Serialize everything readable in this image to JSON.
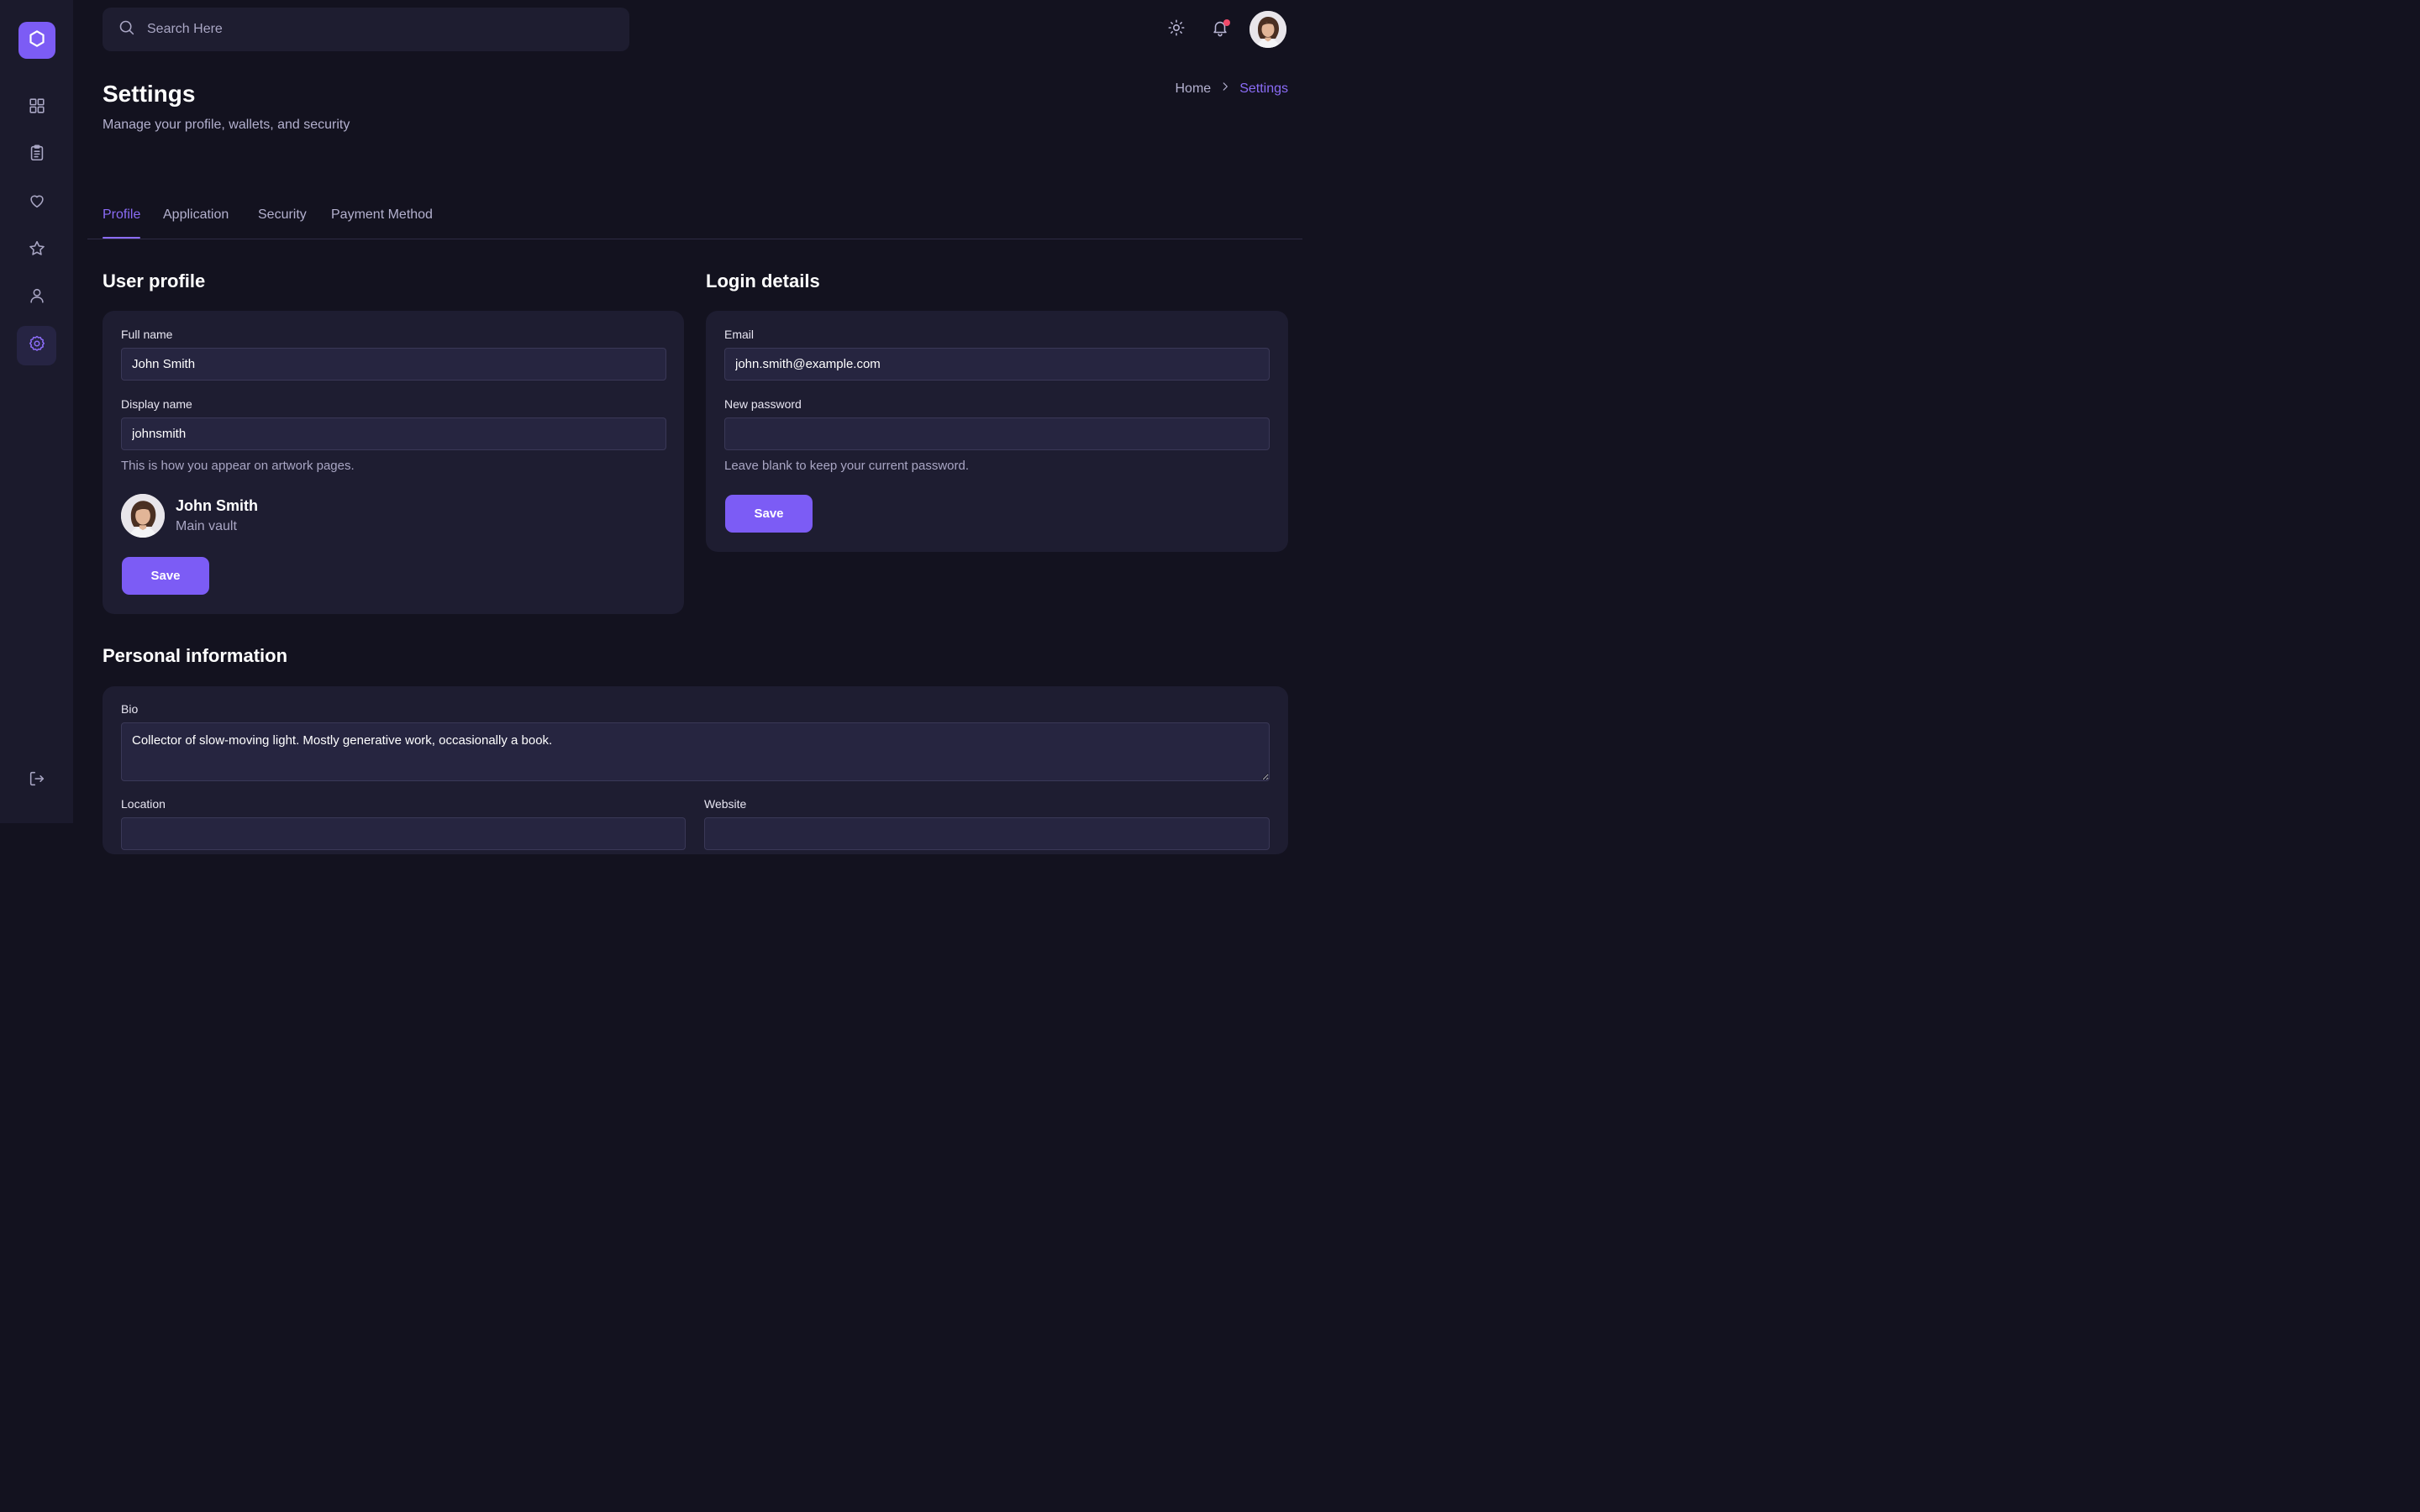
{
  "search": {
    "placeholder": "Search Here"
  },
  "header": {
    "title": "Settings",
    "subtitle": "Manage your profile, wallets, and security",
    "breadcrumb": [
      "Home",
      "Settings"
    ]
  },
  "tabs": [
    {
      "label": "Profile",
      "active": true
    },
    {
      "label": "Application",
      "active": false
    },
    {
      "label": "Security",
      "active": false
    },
    {
      "label": "Payment Method",
      "active": false
    }
  ],
  "sidebar": {
    "items": [
      {
        "icon": "dashboard-grid-icon"
      },
      {
        "icon": "clipboard-icon"
      },
      {
        "icon": "heart-icon"
      },
      {
        "icon": "star-icon"
      },
      {
        "icon": "user-icon"
      },
      {
        "icon": "gear-icon",
        "active": true
      }
    ],
    "bottom": {
      "icon": "logout-icon"
    }
  },
  "user_profile": {
    "title": "User profile",
    "full_name_label": "Full name",
    "full_name_value": "John Smith",
    "display_name_label": "Display name",
    "display_name_value": "johnsmith",
    "hint": "This is how you appear on artwork pages.",
    "preview_name": "John Smith",
    "preview_sub": "Main vault",
    "save_label": "Save"
  },
  "login_details": {
    "title": "Login details",
    "email_label": "Email",
    "email_value": "john.smith@example.com",
    "password_label": "New password",
    "password_value": "",
    "hint": "Leave blank to keep your current password.",
    "save_label": "Save"
  },
  "personal_info": {
    "title": "Personal information",
    "bio_label": "Bio",
    "bio_value": "Collector of slow-moving light. Mostly generative work, occasionally a book.",
    "location_label": "Location",
    "website_label": "Website"
  },
  "colors": {
    "accent": "#7c5cf5",
    "background": "#13121f",
    "sidebar": "#1b1a2c",
    "card": "#1e1d31",
    "notification": "#f04a6a"
  }
}
